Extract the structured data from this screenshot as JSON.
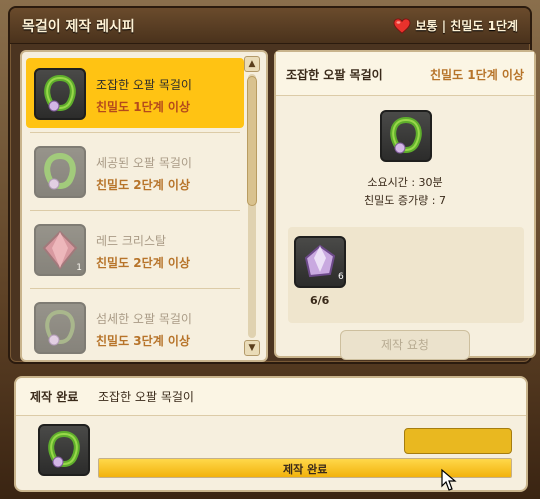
{
  "window": {
    "title": "목걸이 제작 레시피",
    "affinity_label": "보통 | 친밀도 1단계"
  },
  "recipe_list": {
    "items": [
      {
        "name": "조잡한 오팔 목걸이",
        "requirement": "친밀도 1단계 이상",
        "selected": true,
        "icon": "opal-necklace-icon"
      },
      {
        "name": "세공된 오팔 목걸이",
        "requirement": "친밀도 2단계 이상",
        "selected": false,
        "icon": "opal-necklace-icon"
      },
      {
        "name": "레드 크리스탈",
        "requirement": "친밀도 2단계 이상",
        "selected": false,
        "icon": "red-crystal-icon",
        "quantity": "1"
      },
      {
        "name": "섬세한 오팔 목걸이",
        "requirement": "친밀도 3단계 이상",
        "selected": false,
        "icon": "opal-necklace-icon"
      }
    ]
  },
  "detail": {
    "name": "조잡한 오팔 목걸이",
    "requirement": "친밀도 1단계 이상",
    "time_line": "소요시간 : 30분",
    "affinity_gain_line": "친밀도 증가량 : 7",
    "material_quantity": "6",
    "material_count": "6/6",
    "craft_button": "제작 요청"
  },
  "completion": {
    "tag": "제작 완료",
    "name": "조잡한 오팔 목걸이",
    "progress_label": "제작 완료",
    "progress": 1.0
  }
}
